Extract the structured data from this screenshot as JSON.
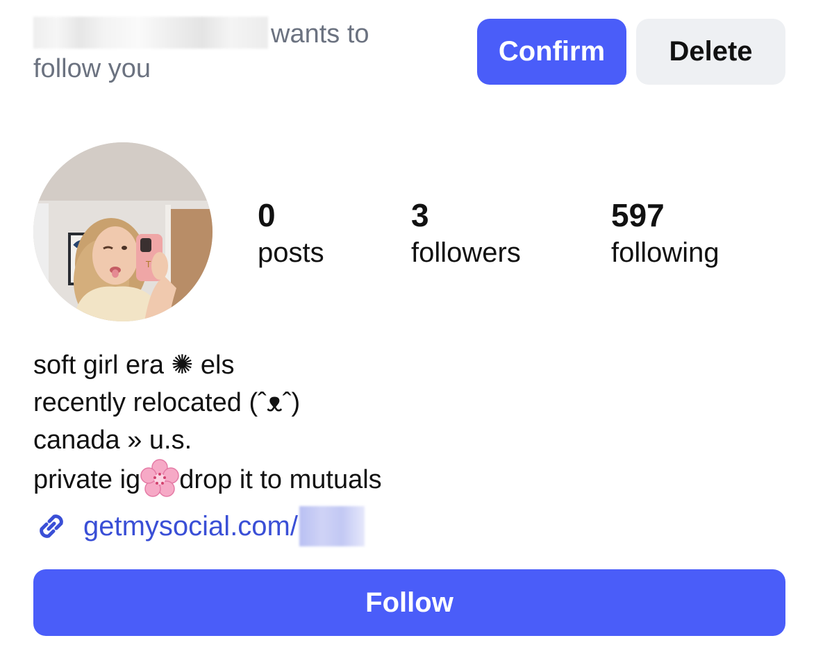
{
  "follow_request": {
    "message": "wants to follow you",
    "confirm_label": "Confirm",
    "delete_label": "Delete"
  },
  "profile": {
    "stats": {
      "posts_count": "0",
      "posts_label": "posts",
      "followers_count": "3",
      "followers_label": "followers",
      "following_count": "597",
      "following_label": "following"
    },
    "bio": {
      "line1": "soft girl era ✺ els",
      "line2": "recently relocated (ˆᴥˆ)",
      "line3": "canada » u.s.",
      "line4_before": "private ig",
      "line4_emoji": "cherry-blossom-emoji",
      "line4_after": "drop it to mutuals"
    },
    "link": {
      "icon": "link-icon",
      "text": "getmysocial.com/"
    },
    "follow_label": "Follow"
  },
  "colors": {
    "accent": "#4a5df9",
    "link": "#3a4fd6",
    "secondary_button": "#eef0f3",
    "muted_text": "#6b7280"
  }
}
